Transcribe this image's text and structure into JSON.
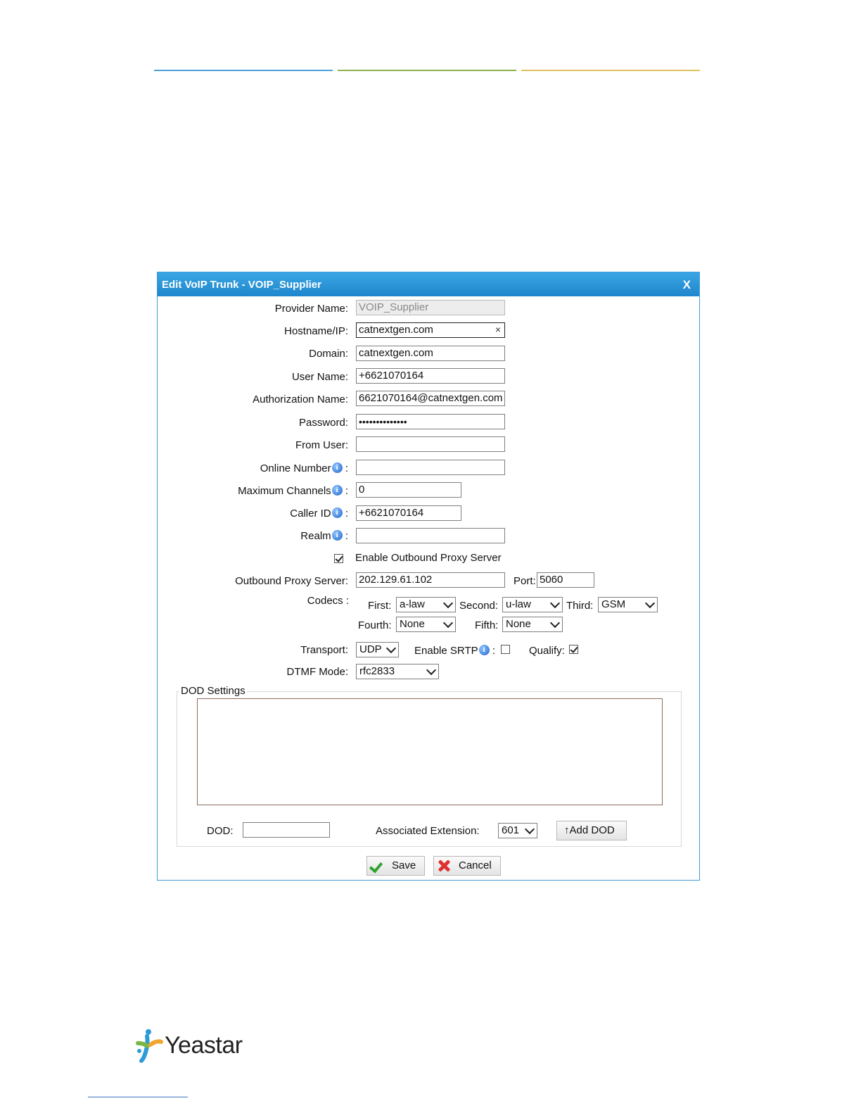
{
  "header": {
    "line_colors": [
      "#4a9fd8",
      "#8fb04a",
      "#e2c15a"
    ]
  },
  "dialog": {
    "title": "Edit VoIP Trunk - VOIP_Supplier",
    "close_label": "X",
    "fields": {
      "provider_name": {
        "label": "Provider Name:",
        "value": "VOIP_Supplier"
      },
      "hostname": {
        "label": "Hostname/IP:",
        "value": "catnextgen.com",
        "clear": "×"
      },
      "domain": {
        "label": "Domain:",
        "value": "catnextgen.com"
      },
      "user_name": {
        "label": "User Name:",
        "value": "+6621070164"
      },
      "auth_name": {
        "label": "Authorization Name:",
        "value": "6621070164@catnextgen.com"
      },
      "password": {
        "label": "Password:",
        "value": "••••••••••••••"
      },
      "from_user": {
        "label": "From User:",
        "value": ""
      },
      "online_number": {
        "label": "Online Number",
        "value": ""
      },
      "max_channels": {
        "label": "Maximum Channels",
        "value": "0"
      },
      "caller_id": {
        "label": "Caller ID",
        "value": "+6621070164"
      },
      "realm": {
        "label": "Realm",
        "value": ""
      }
    },
    "colon": ":",
    "info_glyph": "i",
    "outbound_proxy": {
      "enable_label": "Enable Outbound Proxy Server",
      "enabled": true,
      "server_label": "Outbound Proxy Server:",
      "server_value": "202.129.61.102",
      "port_label": "Port:",
      "port_value": "5060"
    },
    "codecs": {
      "label": "Codecs :",
      "first_label": "First:",
      "first": "a-law",
      "second_label": "Second:",
      "second": "u-law",
      "third_label": "Third:",
      "third": "GSM",
      "fourth_label": "Fourth:",
      "fourth": "None",
      "fifth_label": "Fifth:",
      "fifth": "None"
    },
    "transport": {
      "label": "Transport:",
      "value": "UDP"
    },
    "srtp": {
      "label": "Enable SRTP",
      "enabled": false
    },
    "qualify": {
      "label": "Qualify:",
      "enabled": true
    },
    "dtmf": {
      "label": "DTMF Mode:",
      "value": "rfc2833"
    },
    "dod": {
      "section_label": "DOD Settings",
      "dod_label": "DOD:",
      "dod_value": "",
      "assoc_label": "Associated Extension:",
      "assoc_value": "601",
      "add_button": "↑Add DOD"
    },
    "buttons": {
      "save": "Save",
      "cancel": "Cancel"
    }
  },
  "footer": {
    "brand": "Yeastar"
  }
}
